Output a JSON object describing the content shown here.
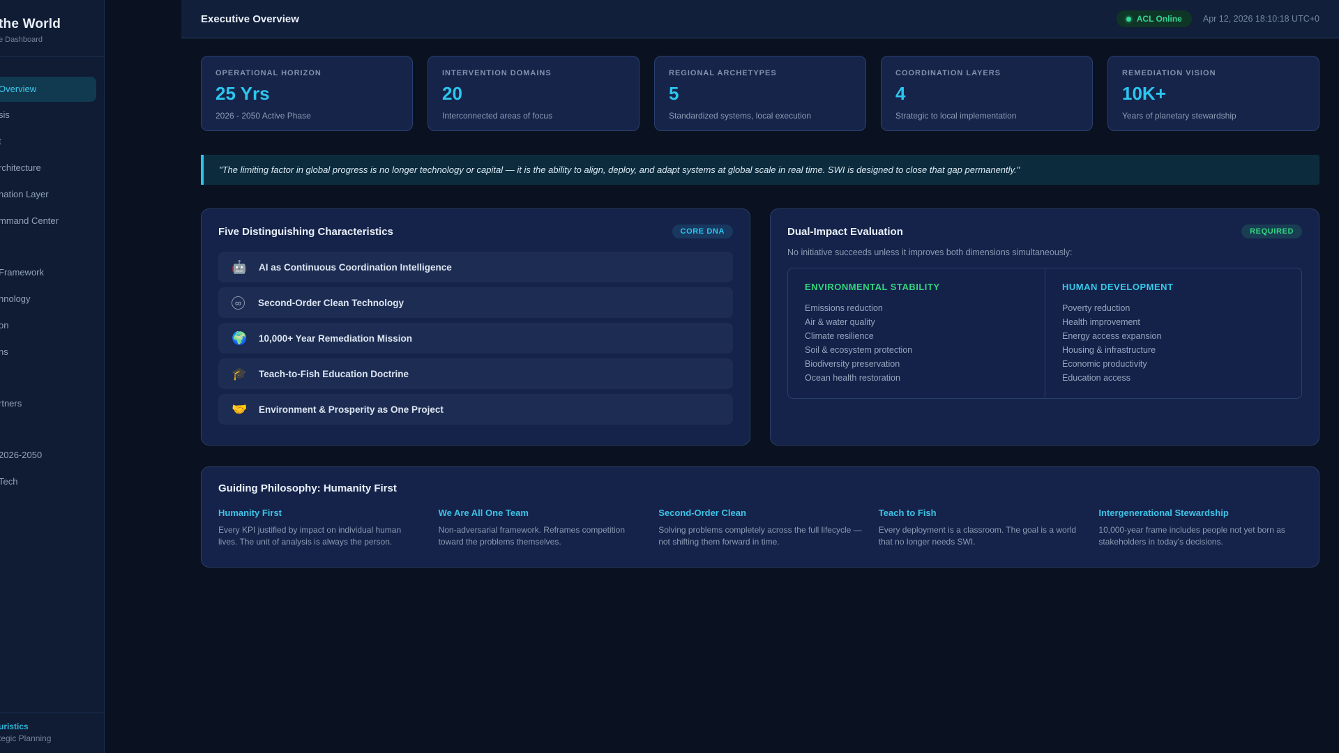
{
  "sidebar": {
    "title_fragment": "the World",
    "subtitle_fragment": "e Dashboard",
    "nav": [
      {
        "label": "Overview"
      },
      {
        "label": "sis"
      },
      {
        "label": "t"
      },
      {
        "label": "rchitecture"
      },
      {
        "label": "nation Layer"
      },
      {
        "label": "mmand Center"
      },
      {
        "label": "Framework"
      },
      {
        "label": "hnology"
      },
      {
        "label": "on"
      },
      {
        "label": "ns"
      },
      {
        "label": "rtners"
      },
      {
        "label": "2026-2050"
      },
      {
        "label": "Tech"
      }
    ],
    "footer": {
      "line1": "uristics",
      "line2": "tegic Planning"
    }
  },
  "header": {
    "title": "Executive Overview",
    "status_label": "ACL Online",
    "timestamp": "Apr 12, 2026 18:10:18 UTC+0"
  },
  "stats": [
    {
      "label": "OPERATIONAL HORIZON",
      "value": "25 Yrs",
      "sub": "2026 - 2050 Active Phase"
    },
    {
      "label": "INTERVENTION DOMAINS",
      "value": "20",
      "sub": "Interconnected areas of focus"
    },
    {
      "label": "REGIONAL ARCHETYPES",
      "value": "5",
      "sub": "Standardized systems, local execution"
    },
    {
      "label": "COORDINATION LAYERS",
      "value": "4",
      "sub": "Strategic to local implementation"
    },
    {
      "label": "REMEDIATION VISION",
      "value": "10K+",
      "sub": "Years of planetary stewardship"
    }
  ],
  "quote": "\"The limiting factor in global progress is no longer technology or capital — it is the ability to align, deploy, and adapt systems at global scale in real time. SWI is designed to close that gap permanently.\"",
  "characteristics": {
    "title": "Five Distinguishing Characteristics",
    "badge": "CORE DNA",
    "items": [
      {
        "icon": "🤖",
        "label": "AI as Continuous Coordination Intelligence"
      },
      {
        "icon": "∞",
        "label": "Second-Order Clean Technology"
      },
      {
        "icon": "🌍",
        "label": "10,000+ Year Remediation Mission"
      },
      {
        "icon": "🎓",
        "label": "Teach-to-Fish Education Doctrine"
      },
      {
        "icon": "🤝",
        "label": "Environment & Prosperity as One Project"
      }
    ]
  },
  "dual_impact": {
    "title": "Dual-Impact Evaluation",
    "badge": "REQUIRED",
    "subtitle": "No initiative succeeds unless it improves both dimensions simultaneously:",
    "environmental": {
      "title": "ENVIRONMENTAL STABILITY",
      "items": [
        "Emissions reduction",
        "Air & water quality",
        "Climate resilience",
        "Soil & ecosystem protection",
        "Biodiversity preservation",
        "Ocean health restoration"
      ]
    },
    "human": {
      "title": "HUMAN DEVELOPMENT",
      "items": [
        "Poverty reduction",
        "Health improvement",
        "Energy access expansion",
        "Housing & infrastructure",
        "Economic productivity",
        "Education access"
      ]
    }
  },
  "philosophy": {
    "title": "Guiding Philosophy: Humanity First",
    "columns": [
      {
        "title": "Humanity First",
        "body": "Every KPI justified by impact on individual human lives. The unit of analysis is always the person."
      },
      {
        "title": "We Are All One Team",
        "body": "Non-adversarial framework. Reframes competition toward the problems themselves."
      },
      {
        "title": "Second-Order Clean",
        "body": "Solving problems completely across the full lifecycle — not shifting them forward in time."
      },
      {
        "title": "Teach to Fish",
        "body": "Every deployment is a classroom. The goal is a world that no longer needs SWI."
      },
      {
        "title": "Intergenerational Stewardship",
        "body": "10,000-year frame includes people not yet born as stakeholders in today's decisions."
      }
    ]
  }
}
